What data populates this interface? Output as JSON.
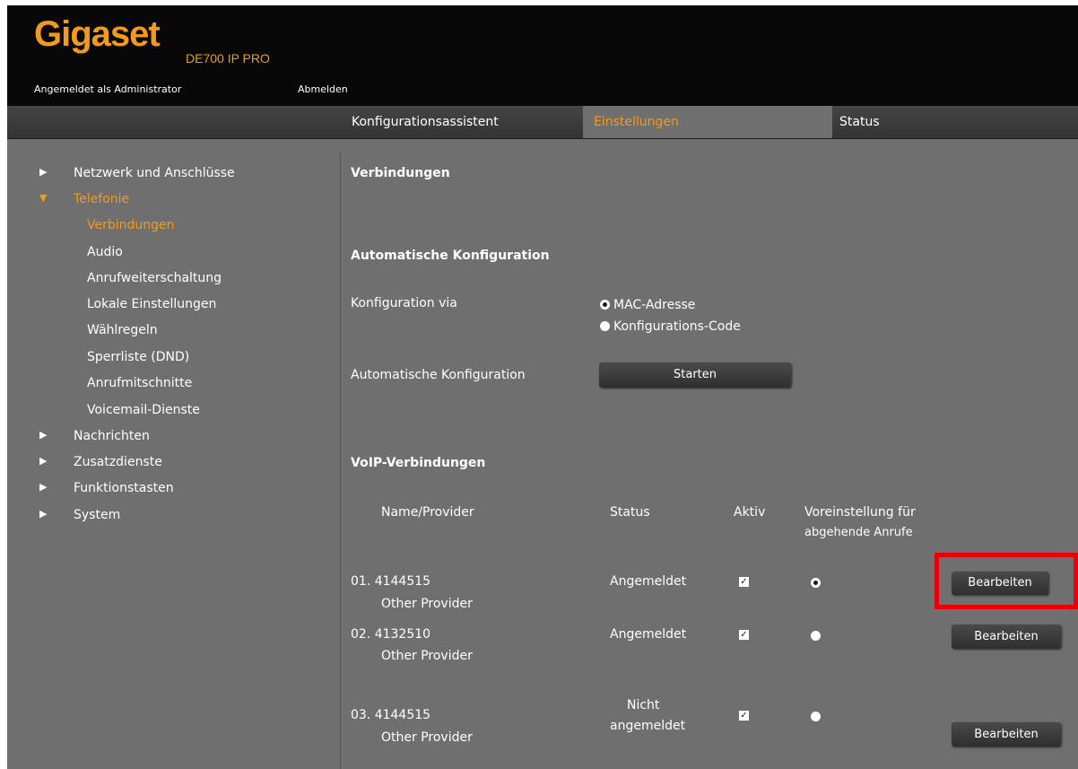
{
  "header": {
    "brand": "Gigaset",
    "model": "DE700 IP PRO",
    "login_info": "Angemeldet als Administrator",
    "logout": "Abmelden"
  },
  "tabs": [
    {
      "label": "Konfigurationsassistent",
      "active": false
    },
    {
      "label": "Einstellungen",
      "active": true
    },
    {
      "label": "Status",
      "active": false
    }
  ],
  "sidebar": {
    "items": [
      {
        "label": "Netzwerk und Anschlüsse",
        "expanded": false
      },
      {
        "label": "Telefonie",
        "expanded": true
      },
      {
        "label": "Nachrichten",
        "expanded": false
      },
      {
        "label": "Zusatzdienste",
        "expanded": false
      },
      {
        "label": "Funktionstasten",
        "expanded": false
      },
      {
        "label": "System",
        "expanded": false
      }
    ],
    "telefonie_sub": [
      {
        "label": "Verbindungen",
        "active": true
      },
      {
        "label": "Audio"
      },
      {
        "label": "Anrufweiterschaltung"
      },
      {
        "label": "Lokale Einstellungen"
      },
      {
        "label": "Wählregeln"
      },
      {
        "label": "Sperrliste (DND)"
      },
      {
        "label": "Anrufmitschnitte"
      },
      {
        "label": "Voicemail-Dienste"
      }
    ]
  },
  "main": {
    "title": "Verbindungen",
    "auto_config": {
      "heading": "Automatische Konfiguration",
      "via_label": "Konfiguration via",
      "options": [
        {
          "label": "MAC-Adresse",
          "selected": true
        },
        {
          "label": "Konfigurations-Code",
          "selected": false
        }
      ],
      "start_label": "Automatische Konfiguration",
      "start_button": "Starten"
    },
    "voip": {
      "heading": "VoIP-Verbindungen",
      "columns": {
        "name": "Name/Provider",
        "status": "Status",
        "active": "Aktiv",
        "default_line1": "Voreinstellung für",
        "default_line2": "abgehende Anrufe"
      },
      "rows": [
        {
          "name": "01. 4144515",
          "provider": "Other Provider",
          "status": "Angemeldet",
          "status2": "",
          "active": true,
          "default": true,
          "button": "Bearbeiten"
        },
        {
          "name": "02. 4132510",
          "provider": "Other Provider",
          "status": "Angemeldet",
          "status2": "",
          "active": true,
          "default": false,
          "button": "Bearbeiten"
        },
        {
          "name": "03. 4144515",
          "provider": "Other Provider",
          "status": "Nicht",
          "status2": "angemeldet",
          "active": true,
          "default": false,
          "button": "Bearbeiten"
        }
      ]
    }
  },
  "colors": {
    "accent": "#f29a1c",
    "background": "#6f6f6f",
    "header": "#080808",
    "highlight": "#e8000b"
  }
}
